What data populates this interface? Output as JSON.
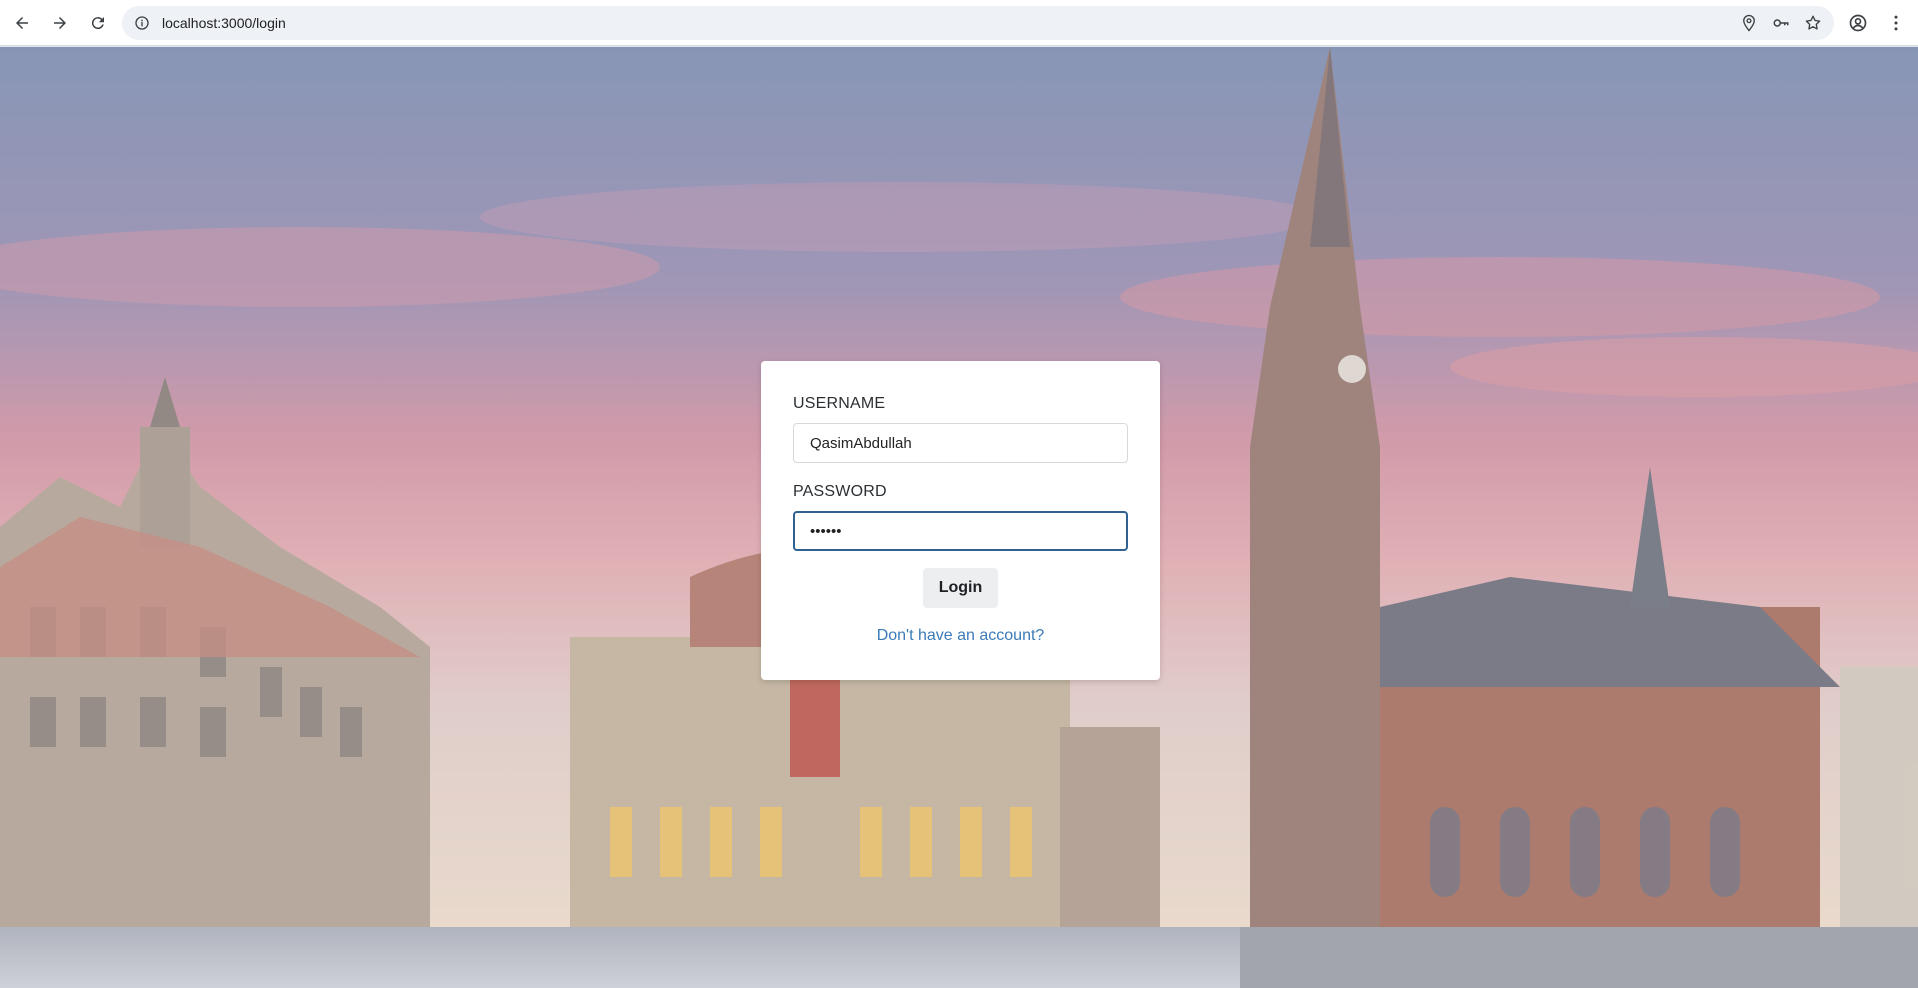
{
  "browser": {
    "url": "localhost:3000/login",
    "icons": {
      "back": "arrow-left-icon",
      "forward": "arrow-right-icon",
      "reload": "reload-icon",
      "info": "info-icon",
      "location": "location-pin-icon",
      "password": "key-icon",
      "bookmark": "star-icon",
      "profile": "account-icon",
      "menu": "kebab-menu-icon"
    }
  },
  "login": {
    "username_label": "USERNAME",
    "username_value": "QasimAbdullah",
    "password_label": "PASSWORD",
    "password_value": "••••••",
    "submit_label": "Login",
    "signup_link": "Don't have an account?"
  },
  "colors": {
    "link": "#3b7bb8",
    "focus_border": "#2f6290",
    "button_bg": "#eceef0"
  }
}
